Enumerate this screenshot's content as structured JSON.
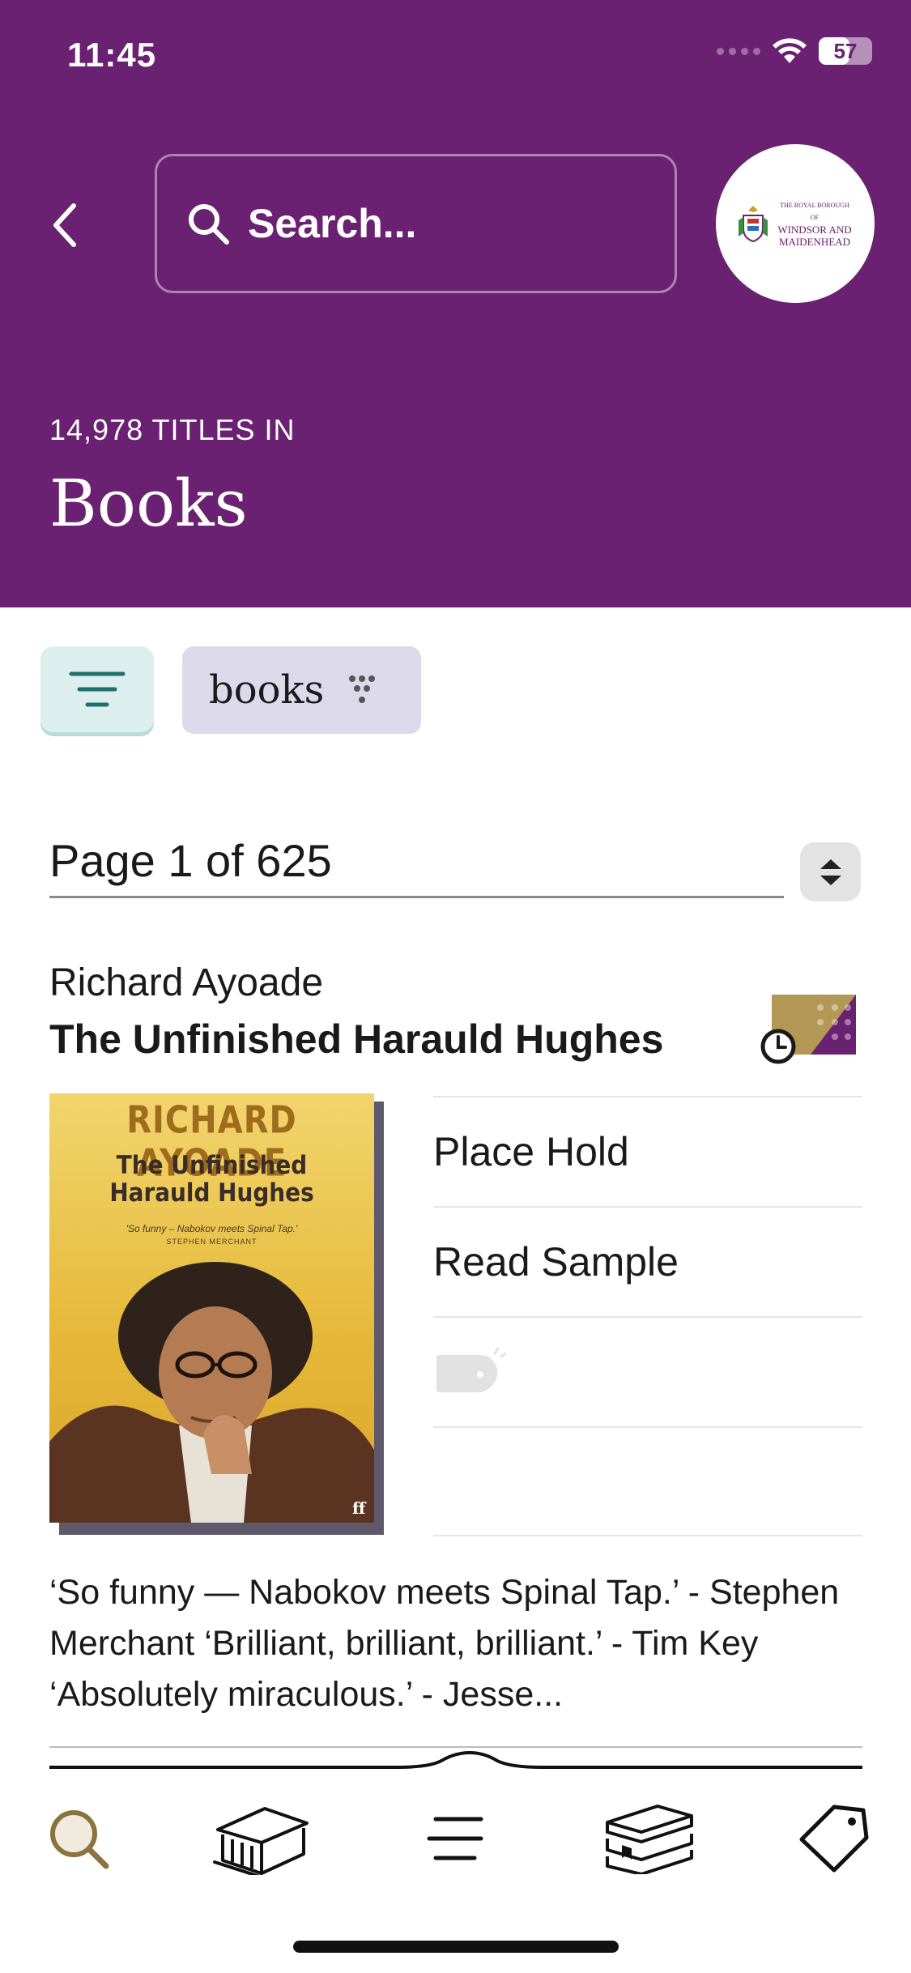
{
  "status_bar": {
    "time": "11:45",
    "battery": "57",
    "battery_level": 0.57
  },
  "header": {
    "back_icon": "chevron-left-icon",
    "search_placeholder": "Search...",
    "library_logo": {
      "line1": "THE ROYAL BOROUGH OF",
      "line2": "WINDSOR AND",
      "line3": "MAIDENHEAD"
    },
    "titles_count": "14,978 TITLES IN",
    "heading": "Books",
    "background_color": "#6b2171"
  },
  "filters": {
    "filter_icon": "filter-lines-icon",
    "chip_label": "books",
    "chip_icon": "funnel-dots-icon"
  },
  "pager": {
    "label": "Page 1 of 625",
    "toggle_icon": "sort-up-down-icon"
  },
  "book": {
    "author": "Richard Ayoade",
    "title": "The Unfinished Harauld Hughes",
    "format_icon": "ebook-audiobook-badge-icon",
    "cover": {
      "author": "RICHARD AYOADE",
      "title_line1": "The Unfinished",
      "title_line2": "Harauld Hughes",
      "quote": "'So funny – Nabokov meets Spinal Tap.'",
      "quoter": "STEPHEN MERCHANT",
      "publisher": "ff"
    },
    "actions": [
      {
        "label": "Place Hold"
      },
      {
        "label": "Read Sample"
      },
      {
        "label": "",
        "icon": "tag-icon"
      },
      {
        "label": ""
      }
    ],
    "description": "‘So funny — Nabokov meets Spinal Tap.’ - Stephen Merchant ‘Brilliant, brilliant, brilliant.’ - Tim Key ‘Absolutely miraculous.’ - Jesse..."
  },
  "tabbar": {
    "tabs": [
      {
        "name": "search",
        "icon": "magnifier-icon",
        "active": true
      },
      {
        "name": "library",
        "icon": "library-building-icon",
        "active": false
      },
      {
        "name": "menu",
        "icon": "menu-lines-icon",
        "active": false
      },
      {
        "name": "shelf",
        "icon": "stacked-books-icon",
        "active": false
      },
      {
        "name": "tags",
        "icon": "tag-icon",
        "active": false
      }
    ],
    "active_color": "#8b7340"
  }
}
